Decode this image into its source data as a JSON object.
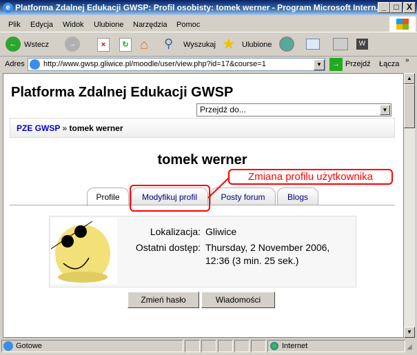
{
  "window": {
    "title": "Platforma Zdalnej Edukacji GWSP: Profil osobisty: tomek werner - Program Microsoft Intern...",
    "min": "_",
    "max": "□",
    "close": "X"
  },
  "menu": [
    "Plik",
    "Edycja",
    "Widok",
    "Ulubione",
    "Narzędzia",
    "Pomoc"
  ],
  "toolbar": {
    "back": "Wstecz",
    "search": "Wyszukaj",
    "favorites": "Ulubione"
  },
  "address": {
    "label": "Adres",
    "url": "http://www.gwsp.gliwice.pl/moodle/user/view.php?id=17&course=1",
    "go": "Przejdź",
    "links": "Łącza"
  },
  "page": {
    "site_title": "Platforma Zdalnej Edukacji GWSP",
    "jump_select": "Przejdź do...",
    "breadcrumb": {
      "home": "PZE GWSP",
      "sep": "»",
      "current": "tomek werner"
    },
    "heading": "tomek werner",
    "annotation": "Zmiana profilu użytkownika",
    "tabs": [
      "Profile",
      "Modyfikuj profil",
      "Posty forum",
      "Blogs"
    ],
    "profile": {
      "loc_label": "Lokalizacja:",
      "loc_value": "Gliwice",
      "access_label": "Ostatni dostęp:",
      "access_line1": "Thursday, 2 November 2006,",
      "access_line2": "12:36  (3 min. 25 sek.)"
    },
    "buttons": [
      "Zmień hasło",
      "Wiadomości"
    ]
  },
  "status": {
    "text": "Gotowe",
    "zone": "Internet"
  },
  "colors": {
    "accent": "#ff0000",
    "link": "#0000cc",
    "tab_text": "#000080"
  }
}
